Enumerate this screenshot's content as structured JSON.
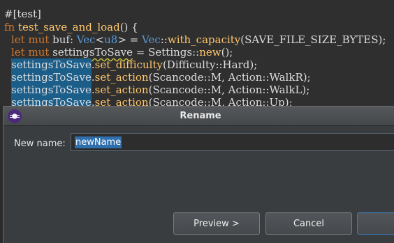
{
  "editor": {
    "attr": "#[test]",
    "l1": {
      "kw": "fn",
      "name": "test_save_and_load",
      "rest": "() {"
    },
    "l2": {
      "kw": "let mut",
      "a": " buf: ",
      "ty1": "Vec",
      "b": "<",
      "ty2": "u8",
      "c": "> = ",
      "ty3": "Vec",
      "d": "::",
      "fn": "with_capacity",
      "e": "(SAVE_FILE_SIZE_BYTES);"
    },
    "l3": {
      "kw": "let mut",
      "sp": " ",
      "var": "settingsToSave",
      "a": " = Settings::",
      "fn": "new",
      "b": "();"
    },
    "l4": {
      "var": "settingsToSave",
      "dot": ".",
      "fn": "set_difficulty",
      "rest": "(Difficulty::Hard);"
    },
    "l5": {
      "var": "settingsToSave",
      "dot": ".",
      "fn": "set_action",
      "rest": "(Scancode::M, Action::WalkR);"
    },
    "l6": {
      "var": "settingsToSave",
      "dot": ".",
      "fn": "set_action",
      "rest": "(Scancode::M, Action::WalkL);"
    },
    "l7": {
      "var": "settingsToSave",
      "dot": ".",
      "fn": "set_action",
      "rest": "(Scancode::M, Action::Up);"
    }
  },
  "dialog": {
    "title": "Rename",
    "name_label": "New name:",
    "name_value": "newName",
    "preview_label": "Preview >",
    "cancel_label": "Cancel",
    "ok_label": ""
  }
}
